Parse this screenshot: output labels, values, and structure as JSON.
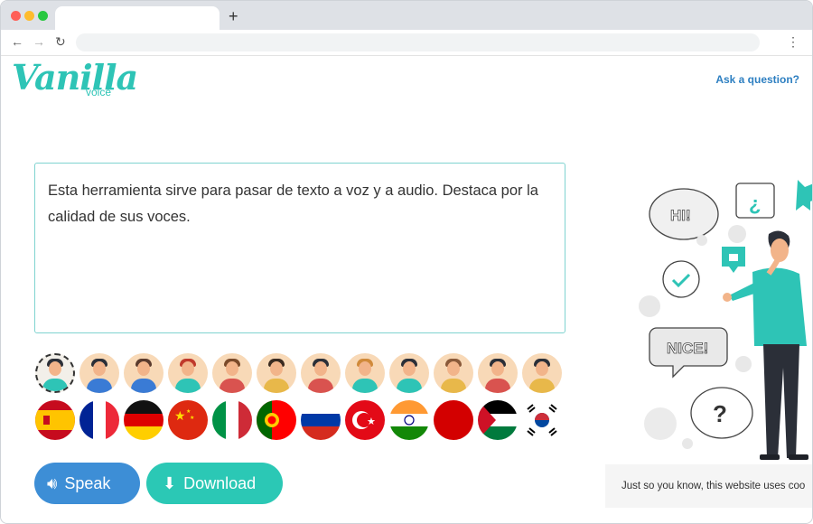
{
  "browser": {
    "new_tab_label": "+"
  },
  "header": {
    "logo_main": "Vanilla",
    "logo_sub": "voice",
    "ask_link": "Ask a question?"
  },
  "textbox": {
    "value": "Esta herramienta sirve para pasar de texto a voz y a audio. Destaca por la calidad de sus voces."
  },
  "voices": [
    {
      "name": "voice-1",
      "hair": "#2b2f38",
      "shirt": "#2ec4b6",
      "selected": true
    },
    {
      "name": "voice-2",
      "hair": "#2b2f38",
      "shirt": "#3a7bd5"
    },
    {
      "name": "voice-3",
      "hair": "#5a3b2e",
      "shirt": "#3a7bd5"
    },
    {
      "name": "voice-4",
      "hair": "#c0392b",
      "shirt": "#2ec4b6"
    },
    {
      "name": "voice-5",
      "hair": "#7a4a2a",
      "shirt": "#d9534f"
    },
    {
      "name": "voice-6",
      "hair": "#3a2a20",
      "shirt": "#e8b84a"
    },
    {
      "name": "voice-7",
      "hair": "#2b2f38",
      "shirt": "#d9534f"
    },
    {
      "name": "voice-8",
      "hair": "#d08a3a",
      "shirt": "#2ec4b6"
    },
    {
      "name": "voice-9",
      "hair": "#2b2f38",
      "shirt": "#2ec4b6"
    },
    {
      "name": "voice-10",
      "hair": "#8a5a3a",
      "shirt": "#e8b84a"
    },
    {
      "name": "voice-11",
      "hair": "#2b2f38",
      "shirt": "#d9534f"
    },
    {
      "name": "voice-12",
      "hair": "#2b2f38",
      "shirt": "#e8b84a"
    }
  ],
  "flags": [
    {
      "name": "flag-spain-icon"
    },
    {
      "name": "flag-france-icon"
    },
    {
      "name": "flag-germany-icon"
    },
    {
      "name": "flag-china-icon"
    },
    {
      "name": "flag-italy-icon"
    },
    {
      "name": "flag-portugal-icon"
    },
    {
      "name": "flag-russia-icon"
    },
    {
      "name": "flag-turkey-icon"
    },
    {
      "name": "flag-india-icon"
    },
    {
      "name": "flag-japan-icon"
    },
    {
      "name": "flag-palestine-icon"
    },
    {
      "name": "flag-south-korea-icon"
    }
  ],
  "actions": {
    "speak_label": "Speak",
    "download_label": "Download"
  },
  "illustration": {
    "bubble_hi": "HI!",
    "bubble_nice": "NICE!",
    "bubble_question": "?",
    "bubble_inverted_question": "¿"
  },
  "cookie_banner": {
    "text": "Just so you know, this website uses coo"
  },
  "colors": {
    "brand_teal": "#2ec4b6",
    "speak_blue": "#3d8ed6",
    "download_teal": "#2bc8b5",
    "link_blue": "#2d7fc1"
  }
}
